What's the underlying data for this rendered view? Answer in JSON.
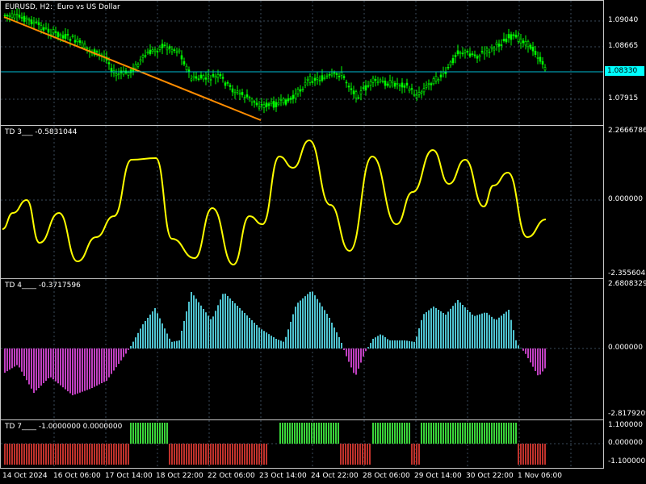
{
  "chart": {
    "symbol_title": "EURUSD, H2:  Euro vs US Dollar",
    "current_price": "1.08330",
    "colors": {
      "background": "#000000",
      "grid": "#3a4a5a",
      "bull": "#00ff00",
      "bear": "#00ff00",
      "trendline": "#ff8c00",
      "price_line": "#00bcd4",
      "td3_line": "#ffff00",
      "td4_pos": "#4fc3d0",
      "td4_neg": "#c040c0",
      "td7_pos": "#3ad43a",
      "td7_neg": "#c0322c"
    }
  },
  "main_pane": {
    "y_labels": [
      "1.09040",
      "1.08665",
      "1.07915"
    ]
  },
  "td3": {
    "label": "TD 3___ -0.5831044",
    "y_labels": [
      "2.2666786",
      "0.000000",
      "-2.3556043"
    ]
  },
  "td4": {
    "label": "TD 4____ -0.3717596",
    "y_labels": [
      "2.6808329",
      "0.000000",
      "-2.8179209"
    ]
  },
  "td7": {
    "label": "TD 7____ -1.0000000 0.0000000",
    "y_labels": [
      "1.100000",
      "0.000000",
      "-1.100000"
    ]
  },
  "x_axis": {
    "labels": [
      "14 Oct 2024",
      "16 Oct 06:00",
      "17 Oct 14:00",
      "18 Oct 22:00",
      "22 Oct 06:00",
      "23 Oct 14:00",
      "24 Oct 22:00",
      "28 Oct 06:00",
      "29 Oct 14:00",
      "30 Oct 22:00",
      "1 Nov 06:00"
    ]
  }
}
